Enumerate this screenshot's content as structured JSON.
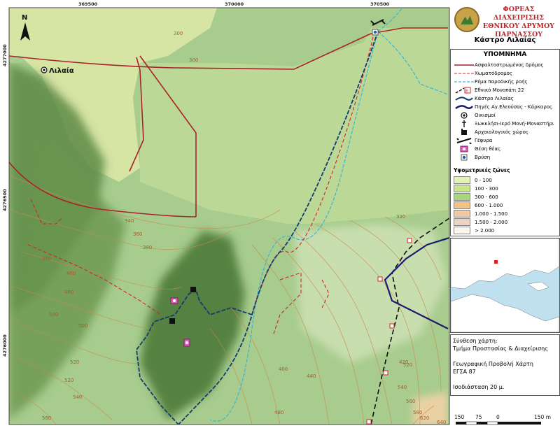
{
  "map": {
    "settlement_label": "Λιλαία",
    "north_symbol": "N",
    "grid_x_labels": [
      "369500",
      "370000",
      "370500"
    ],
    "grid_y_labels": [
      "4277000",
      "4276500",
      "4276000"
    ],
    "contour_labels": [
      "300",
      "300",
      "320",
      "340",
      "360",
      "380",
      "400",
      "420",
      "440",
      "460",
      "460",
      "480",
      "480",
      "500",
      "500",
      "520",
      "520",
      "520",
      "540",
      "540",
      "560",
      "560",
      "580",
      "620",
      "640"
    ]
  },
  "header": {
    "org_lines": [
      "ΦΟΡΕΑΣ ΔΙΑΧΕΙΡΙΣΗΣ",
      "ΕΘΝΙΚΟΥ ΔΡΥΜΟΥ",
      "ΠΑΡΝΑΣΣΟΥ"
    ],
    "map_title": "Κάστρο Λιλαίας"
  },
  "legend": {
    "title": "ΥΠΟΜΝΗΜΑ",
    "items": [
      {
        "label": "Ασφαλτοστρωμένος δρόμος",
        "icon": "paved-road-line"
      },
      {
        "label": "Χωματόδρομος",
        "icon": "dirt-road-dashed-line"
      },
      {
        "label": "Ρέμα παροδικής ροής",
        "icon": "stream-line"
      },
      {
        "label": "Εθνικό Μονοπάτι 22",
        "icon": "national-trail-line"
      },
      {
        "label": "Κάστρο Λιλαίας",
        "icon": "castle-trail-line"
      },
      {
        "label": "Πηγές Αγ.Ελεούσας - Κάρκαρος",
        "icon": "springs-trail-line"
      },
      {
        "label": "Οικισμοί",
        "icon": "settlement-icon"
      },
      {
        "label": "Ξωκκλήσι-Ιερό Μονή-Μοναστήρι",
        "icon": "chapel-icon"
      },
      {
        "label": "Αρχαιολογικός χώρος",
        "icon": "archaeological-site-icon"
      },
      {
        "label": "Γέφυρα",
        "icon": "bridge-icon"
      },
      {
        "label": "Θέση θέας",
        "icon": "viewpoint-icon"
      },
      {
        "label": "Βρύση",
        "icon": "fountain-icon"
      }
    ],
    "zones_title": "Υψομετρικές ζώνες",
    "zones": [
      {
        "label": "0 - 100",
        "color": "#e3f3b4"
      },
      {
        "label": "100 - 300",
        "color": "#c8e68b"
      },
      {
        "label": "300 - 600",
        "color": "#a9d67b"
      },
      {
        "label": "600 - 1.000",
        "color": "#f1c484"
      },
      {
        "label": "1.000 - 1.500",
        "color": "#f0c8a2"
      },
      {
        "label": "1.500 - 2.000",
        "color": "#ecd2c3"
      },
      {
        "label": "> 2.000",
        "color": "#fbf7ef"
      }
    ]
  },
  "info": {
    "lines": [
      "Σύνθεση χάρτη:",
      "Τμήμα Προστασίας & Διαχείρισης",
      "",
      "Γεωγραφική Προβολή Χάρτη",
      "ΕΓΣΑ 87",
      "",
      "Ισοδιάσταση 20 μ."
    ]
  },
  "scale": {
    "labels": [
      "150",
      "75",
      "0",
      "150 m"
    ]
  },
  "colors": {
    "paved_road": "#a8222a",
    "dirt_road": "#d2242a",
    "stream": "#3bb6d0",
    "castle_trail": "#153a6e",
    "springs_trail": "#1c1a6a",
    "contour": "#c98a4e"
  }
}
